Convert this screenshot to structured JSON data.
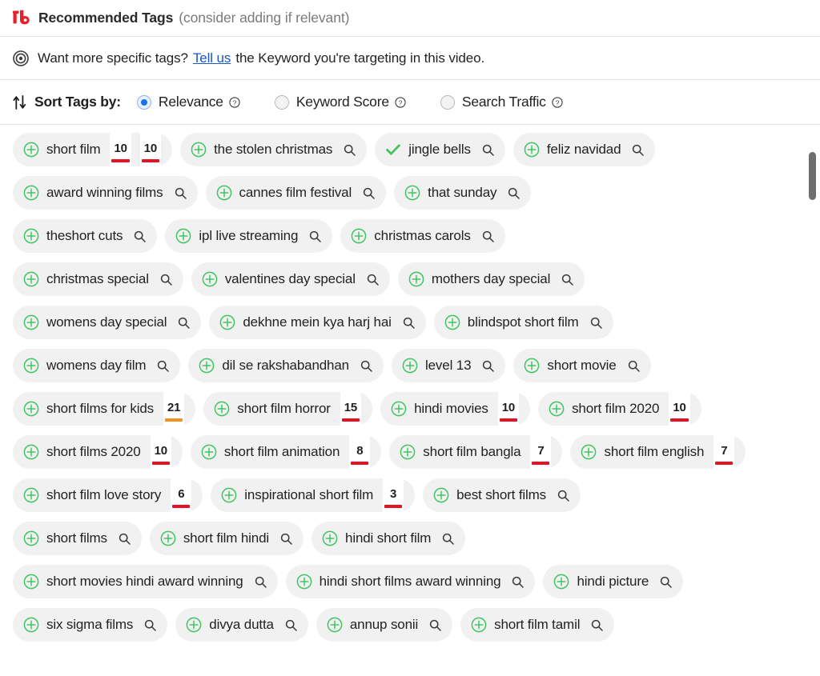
{
  "header": {
    "logo_icon": "tubebuddy-logo-icon",
    "title": "Recommended Tags",
    "subtitle": "(consider adding if relevant)"
  },
  "target_notice": {
    "icon": "target-bullseye-icon",
    "text_before": "Want more specific tags?",
    "link_label": "Tell us",
    "text_after": "the Keyword you're targeting in this video."
  },
  "sort": {
    "icon": "sort-arrows-icon",
    "label": "Sort Tags by:",
    "options": [
      {
        "label": "Relevance",
        "selected": true,
        "help_icon": "help-circle-icon"
      },
      {
        "label": "Keyword Score",
        "selected": false,
        "help_icon": "help-circle-icon"
      },
      {
        "label": "Search Traffic",
        "selected": false,
        "help_icon": "help-circle-icon"
      }
    ]
  },
  "colors": {
    "brand_red": "#e8202a",
    "accent_blue": "#1a73e8",
    "link_blue": "#1a56c4",
    "add_green": "#43c463",
    "score_red": "#e81123",
    "score_orange": "#f0931f",
    "pill_bg": "#f1f1f1",
    "panel_bg": "#ffffff"
  },
  "scrollbar": {
    "orientation": "vertical",
    "thumb_position_percent": 1
  },
  "tag_rows": [
    [
      {
        "label": "short film",
        "state": "add",
        "icon": "plus-circle-icon",
        "action_icon": null,
        "scores": [
          {
            "value": "10",
            "bar": "red"
          },
          {
            "value": "10",
            "bar": "red"
          }
        ]
      },
      {
        "label": "the stolen christmas",
        "state": "add",
        "icon": "plus-circle-icon",
        "action_icon": "search-icon",
        "scores": []
      },
      {
        "label": "jingle bells",
        "state": "added",
        "icon": "check-icon",
        "action_icon": "search-icon",
        "scores": []
      },
      {
        "label": "feliz navidad",
        "state": "add",
        "icon": "plus-circle-icon",
        "action_icon": "search-icon",
        "scores": []
      }
    ],
    [
      {
        "label": "award winning films",
        "state": "add",
        "icon": "plus-circle-icon",
        "action_icon": "search-icon",
        "scores": []
      },
      {
        "label": "cannes film festival",
        "state": "add",
        "icon": "plus-circle-icon",
        "action_icon": "search-icon",
        "scores": []
      },
      {
        "label": "that sunday",
        "state": "add",
        "icon": "plus-circle-icon",
        "action_icon": "search-icon",
        "scores": []
      }
    ],
    [
      {
        "label": "theshort cuts",
        "state": "add",
        "icon": "plus-circle-icon",
        "action_icon": "search-icon",
        "scores": []
      },
      {
        "label": "ipl live streaming",
        "state": "add",
        "icon": "plus-circle-icon",
        "action_icon": "search-icon",
        "scores": []
      },
      {
        "label": "christmas carols",
        "state": "add",
        "icon": "plus-circle-icon",
        "action_icon": "search-icon",
        "scores": []
      }
    ],
    [
      {
        "label": "christmas special",
        "state": "add",
        "icon": "plus-circle-icon",
        "action_icon": "search-icon",
        "scores": []
      },
      {
        "label": "valentines day special",
        "state": "add",
        "icon": "plus-circle-icon",
        "action_icon": "search-icon",
        "scores": []
      },
      {
        "label": "mothers day special",
        "state": "add",
        "icon": "plus-circle-icon",
        "action_icon": "search-icon",
        "scores": []
      }
    ],
    [
      {
        "label": "womens day special",
        "state": "add",
        "icon": "plus-circle-icon",
        "action_icon": "search-icon",
        "scores": []
      },
      {
        "label": "dekhne mein kya harj hai",
        "state": "add",
        "icon": "plus-circle-icon",
        "action_icon": "search-icon",
        "scores": []
      },
      {
        "label": "blindspot short film",
        "state": "add",
        "icon": "plus-circle-icon",
        "action_icon": "search-icon",
        "scores": []
      }
    ],
    [
      {
        "label": "womens day film",
        "state": "add",
        "icon": "plus-circle-icon",
        "action_icon": "search-icon",
        "scores": []
      },
      {
        "label": "dil se rakshabandhan",
        "state": "add",
        "icon": "plus-circle-icon",
        "action_icon": "search-icon",
        "scores": []
      },
      {
        "label": "level 13",
        "state": "add",
        "icon": "plus-circle-icon",
        "action_icon": "search-icon",
        "scores": []
      },
      {
        "label": "short movie",
        "state": "add",
        "icon": "plus-circle-icon",
        "action_icon": "search-icon",
        "scores": []
      }
    ],
    [
      {
        "label": "short films for kids",
        "state": "add",
        "icon": "plus-circle-icon",
        "action_icon": null,
        "scores": [
          {
            "value": "21",
            "bar": "orange"
          }
        ]
      },
      {
        "label": "short film horror",
        "state": "add",
        "icon": "plus-circle-icon",
        "action_icon": null,
        "scores": [
          {
            "value": "15",
            "bar": "red"
          }
        ]
      },
      {
        "label": "hindi movies",
        "state": "add",
        "icon": "plus-circle-icon",
        "action_icon": null,
        "scores": [
          {
            "value": "10",
            "bar": "red"
          }
        ]
      },
      {
        "label": "short film 2020",
        "state": "add",
        "icon": "plus-circle-icon",
        "action_icon": null,
        "scores": [
          {
            "value": "10",
            "bar": "red"
          }
        ]
      }
    ],
    [
      {
        "label": "short films 2020",
        "state": "add",
        "icon": "plus-circle-icon",
        "action_icon": null,
        "scores": [
          {
            "value": "10",
            "bar": "red"
          }
        ]
      },
      {
        "label": "short film animation",
        "state": "add",
        "icon": "plus-circle-icon",
        "action_icon": null,
        "scores": [
          {
            "value": "8",
            "bar": "red"
          }
        ]
      },
      {
        "label": "short film bangla",
        "state": "add",
        "icon": "plus-circle-icon",
        "action_icon": null,
        "scores": [
          {
            "value": "7",
            "bar": "red"
          }
        ]
      },
      {
        "label": "short film english",
        "state": "add",
        "icon": "plus-circle-icon",
        "action_icon": null,
        "scores": [
          {
            "value": "7",
            "bar": "red"
          }
        ]
      }
    ],
    [
      {
        "label": "short film love story",
        "state": "add",
        "icon": "plus-circle-icon",
        "action_icon": null,
        "scores": [
          {
            "value": "6",
            "bar": "red"
          }
        ]
      },
      {
        "label": "inspirational short film",
        "state": "add",
        "icon": "plus-circle-icon",
        "action_icon": null,
        "scores": [
          {
            "value": "3",
            "bar": "red"
          }
        ]
      },
      {
        "label": "best short films",
        "state": "add",
        "icon": "plus-circle-icon",
        "action_icon": "search-icon",
        "scores": []
      }
    ],
    [
      {
        "label": "short films",
        "state": "add",
        "icon": "plus-circle-icon",
        "action_icon": "search-icon",
        "scores": []
      },
      {
        "label": "short film hindi",
        "state": "add",
        "icon": "plus-circle-icon",
        "action_icon": "search-icon",
        "scores": []
      },
      {
        "label": "hindi short film",
        "state": "add",
        "icon": "plus-circle-icon",
        "action_icon": "search-icon",
        "scores": []
      }
    ],
    [
      {
        "label": "short movies hindi award winning",
        "state": "add",
        "icon": "plus-circle-icon",
        "action_icon": "search-icon",
        "scores": []
      },
      {
        "label": "hindi short films award winning",
        "state": "add",
        "icon": "plus-circle-icon",
        "action_icon": "search-icon",
        "scores": []
      },
      {
        "label": "hindi picture",
        "state": "add",
        "icon": "plus-circle-icon",
        "action_icon": "search-icon",
        "scores": []
      }
    ],
    [
      {
        "label": "six sigma films",
        "state": "add",
        "icon": "plus-circle-icon",
        "action_icon": "search-icon",
        "scores": []
      },
      {
        "label": "divya dutta",
        "state": "add",
        "icon": "plus-circle-icon",
        "action_icon": "search-icon",
        "scores": []
      },
      {
        "label": "annup sonii",
        "state": "add",
        "icon": "plus-circle-icon",
        "action_icon": "search-icon",
        "scores": []
      },
      {
        "label": "short film tamil",
        "state": "add",
        "icon": "plus-circle-icon",
        "action_icon": "search-icon",
        "scores": []
      }
    ]
  ]
}
